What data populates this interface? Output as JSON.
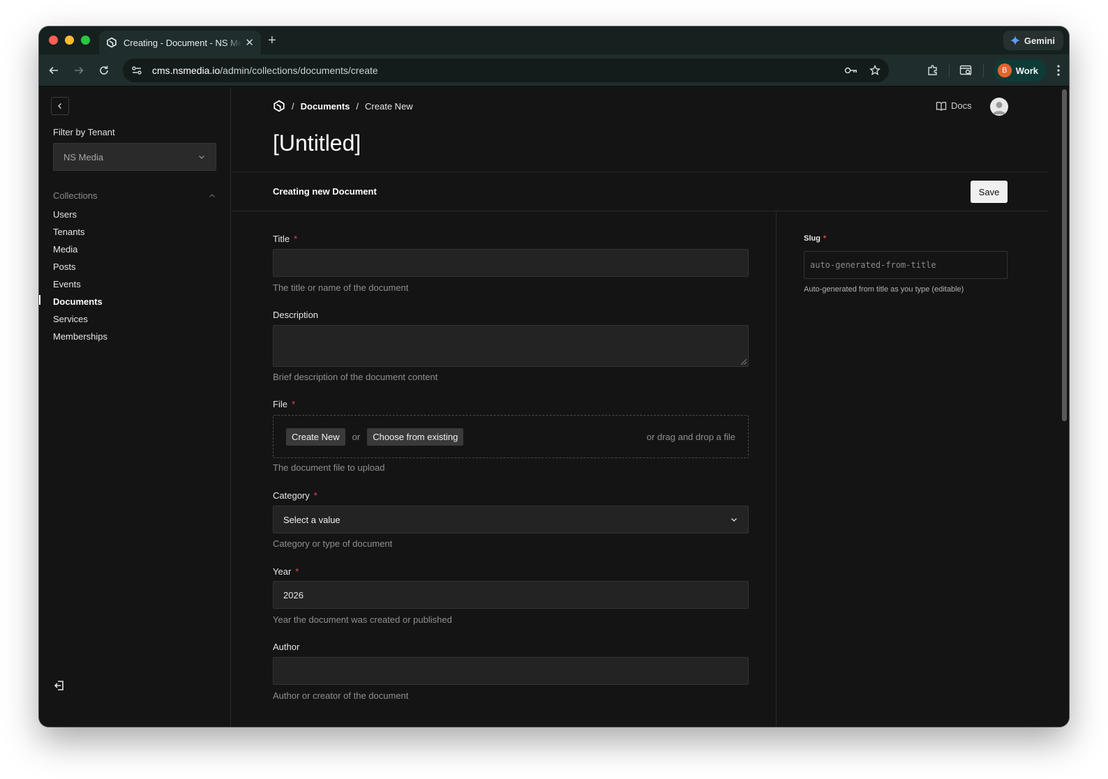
{
  "browser": {
    "tab_title": "Creating - Document - NS Media",
    "url_host": "cms.nsmedia.io",
    "url_path": "/admin/collections/documents/create",
    "gemini_label": "Gemini",
    "profile_label": "Work",
    "profile_initial": "B",
    "new_tab": "+",
    "close_tab": "✕"
  },
  "sidebar": {
    "filter_label": "Filter by Tenant",
    "tenant_value": "NS Media",
    "collections_label": "Collections",
    "items": [
      {
        "label": "Users"
      },
      {
        "label": "Tenants"
      },
      {
        "label": "Media"
      },
      {
        "label": "Posts"
      },
      {
        "label": "Events"
      },
      {
        "label": "Documents"
      },
      {
        "label": "Services"
      },
      {
        "label": "Memberships"
      }
    ],
    "active_item": "Documents"
  },
  "header": {
    "separator": "/",
    "breadcrumb_collection": "Documents",
    "breadcrumb_current": "Create New",
    "docs_label": "Docs",
    "page_title": "[Untitled]",
    "subtitle": "Creating new Document",
    "save_label": "Save"
  },
  "form": {
    "required_mark": "*",
    "title": {
      "label": "Title",
      "value": "",
      "help": "The title or name of the document"
    },
    "description": {
      "label": "Description",
      "value": "",
      "help": "Brief description of the document content"
    },
    "file": {
      "label": "File",
      "create_new": "Create New",
      "or": "or",
      "choose_existing": "Choose from existing",
      "drag_drop": "or drag and drop a file",
      "help": "The document file to upload"
    },
    "category": {
      "label": "Category",
      "value": "Select a value",
      "help": "Category or type of document"
    },
    "year": {
      "label": "Year",
      "value": "2026",
      "help": "Year the document was created or published"
    },
    "author": {
      "label": "Author",
      "value": "",
      "help": "Author or creator of the document"
    }
  },
  "side_panel": {
    "slug_label": "Slug",
    "slug_placeholder": "auto-generated-from-title",
    "slug_help": "Auto-generated from title as you type (editable)"
  }
}
